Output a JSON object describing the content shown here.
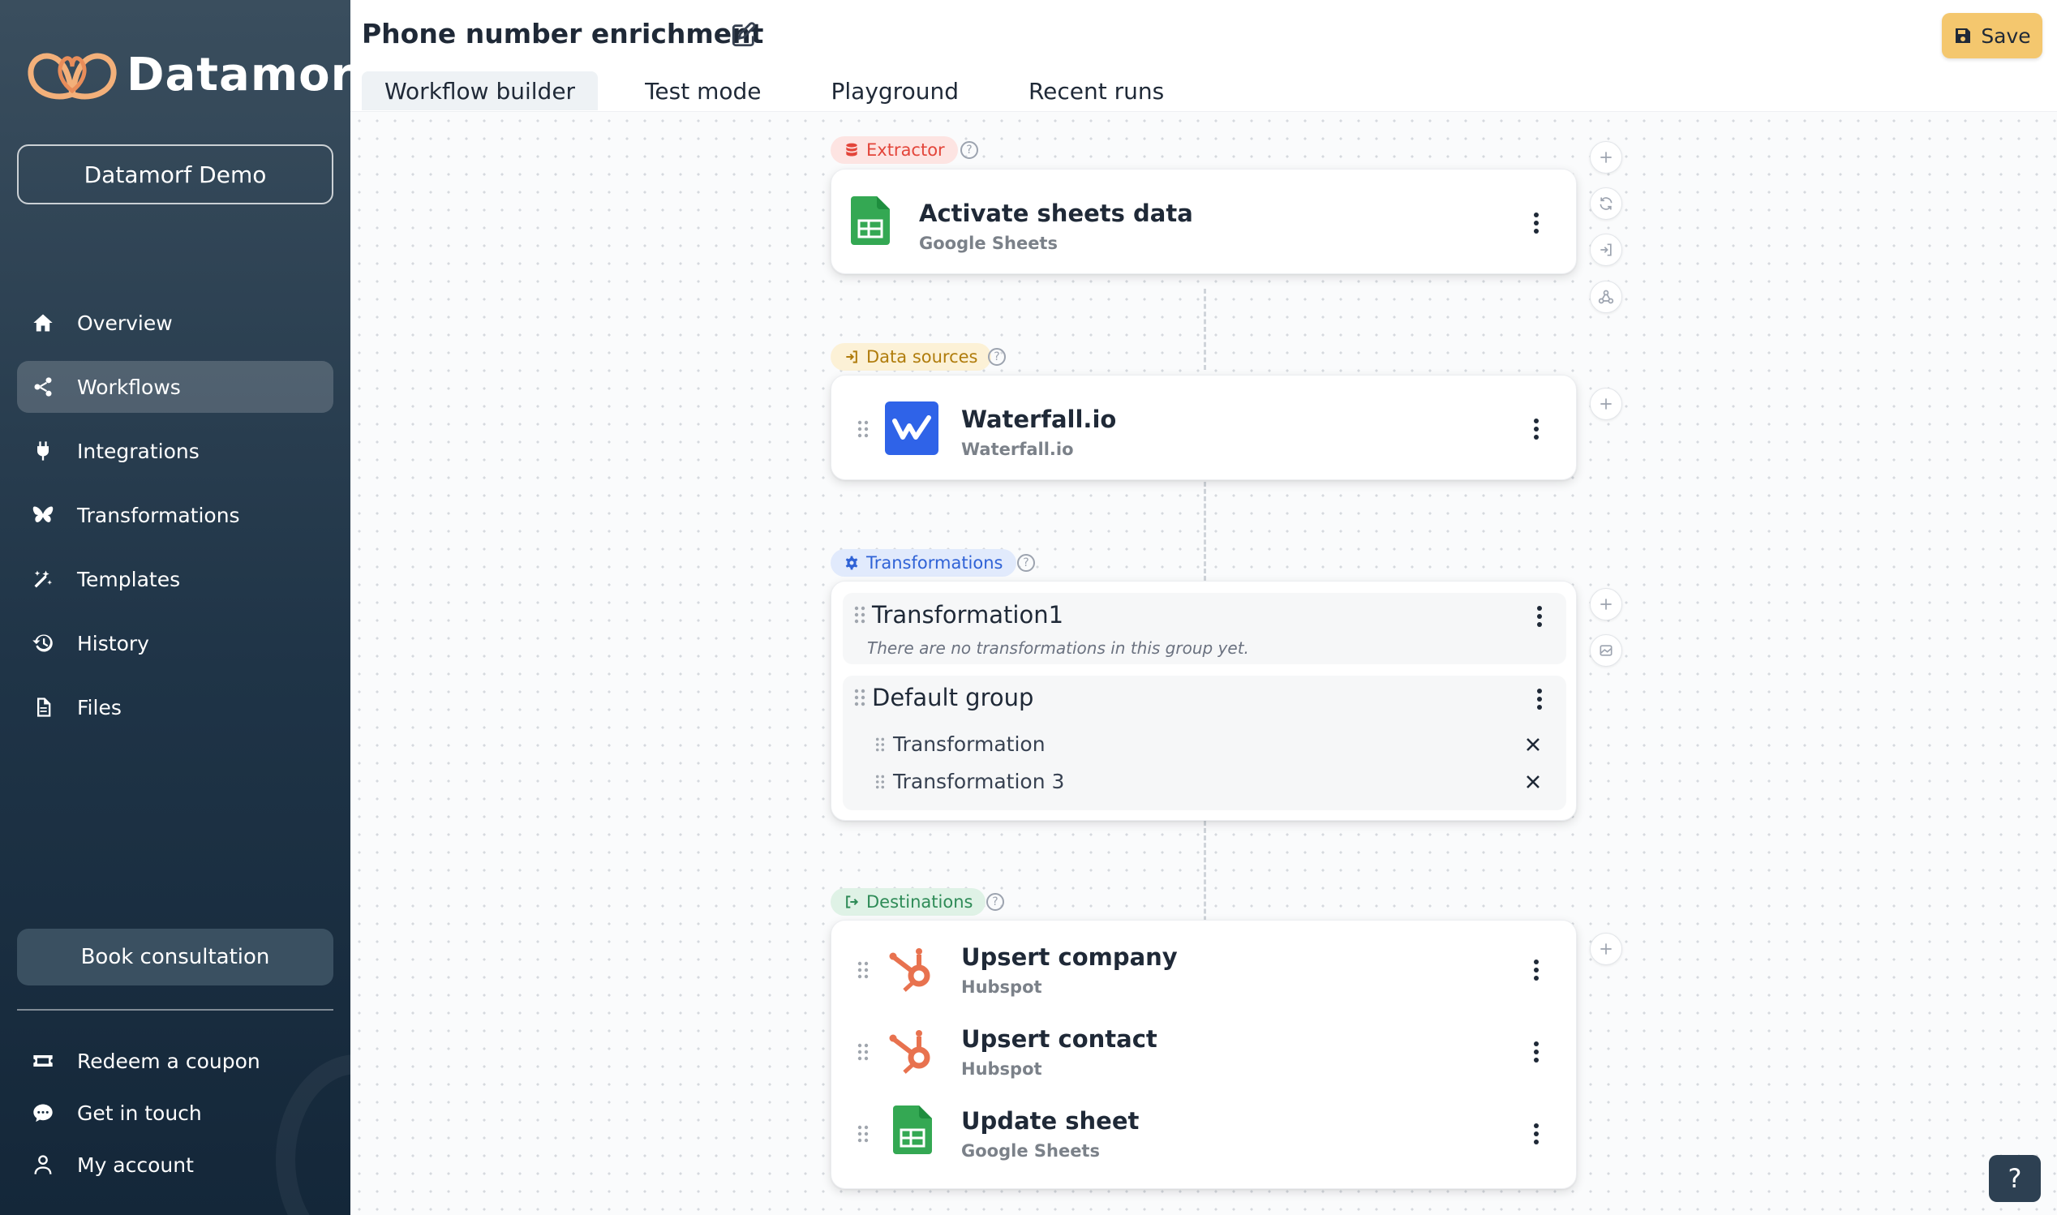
{
  "app": {
    "brand": "Datamorf",
    "organization": "Datamorf Demo"
  },
  "sidebar": {
    "items": [
      {
        "label": "Overview",
        "icon": "home-icon"
      },
      {
        "label": "Workflows",
        "icon": "share-icon"
      },
      {
        "label": "Integrations",
        "icon": "plug-icon"
      },
      {
        "label": "Transformations",
        "icon": "butterfly-icon"
      },
      {
        "label": "Templates",
        "icon": "magic-wand-icon"
      },
      {
        "label": "History",
        "icon": "history-icon"
      },
      {
        "label": "Files",
        "icon": "file-icon"
      }
    ],
    "active_item": "Workflows",
    "book_label": "Book consultation",
    "bottom_items": [
      {
        "label": "Redeem a coupon",
        "icon": "ticket-icon"
      },
      {
        "label": "Get in touch",
        "icon": "chat-icon"
      },
      {
        "label": "My account",
        "icon": "user-icon"
      }
    ]
  },
  "header": {
    "title": "Phone number enrichment",
    "save_label": "Save",
    "tabs": [
      "Workflow builder",
      "Test mode",
      "Playground",
      "Recent runs"
    ],
    "active_tab": "Workflow builder"
  },
  "workflow": {
    "extractor": {
      "tag": "Extractor",
      "color": "#e3453a",
      "node": {
        "title": "Activate sheets data",
        "subtitle": "Google Sheets",
        "icon": "google-sheets-icon"
      }
    },
    "data_sources": {
      "tag": "Data sources",
      "color": "#c79216",
      "node": {
        "title": "Waterfall.io",
        "subtitle": "Waterfall.io",
        "icon": "waterfall-icon"
      }
    },
    "transformations": {
      "tag": "Transformations",
      "color": "#2f62d6",
      "groups": [
        {
          "title": "Transformation1",
          "empty_text": "There are no transformations in this group yet.",
          "items": []
        },
        {
          "title": "Default group",
          "items": [
            "Transformation",
            "Transformation 3"
          ]
        }
      ]
    },
    "destinations": {
      "tag": "Destinations",
      "color": "#2e8b57",
      "nodes": [
        {
          "title": "Upsert company",
          "subtitle": "Hubspot",
          "icon": "hubspot-icon"
        },
        {
          "title": "Upsert contact",
          "subtitle": "Hubspot",
          "icon": "hubspot-icon"
        },
        {
          "title": "Update sheet",
          "subtitle": "Google Sheets",
          "icon": "google-sheets-icon"
        }
      ]
    }
  },
  "help_label": "?",
  "colors": {
    "sidebar_top": "#3a4e5e",
    "sidebar_bottom": "#142739",
    "save_button": "#f4c76e",
    "hubspot": "#e8724f",
    "sheets": "#34a853",
    "waterfall": "#2f63e8"
  }
}
